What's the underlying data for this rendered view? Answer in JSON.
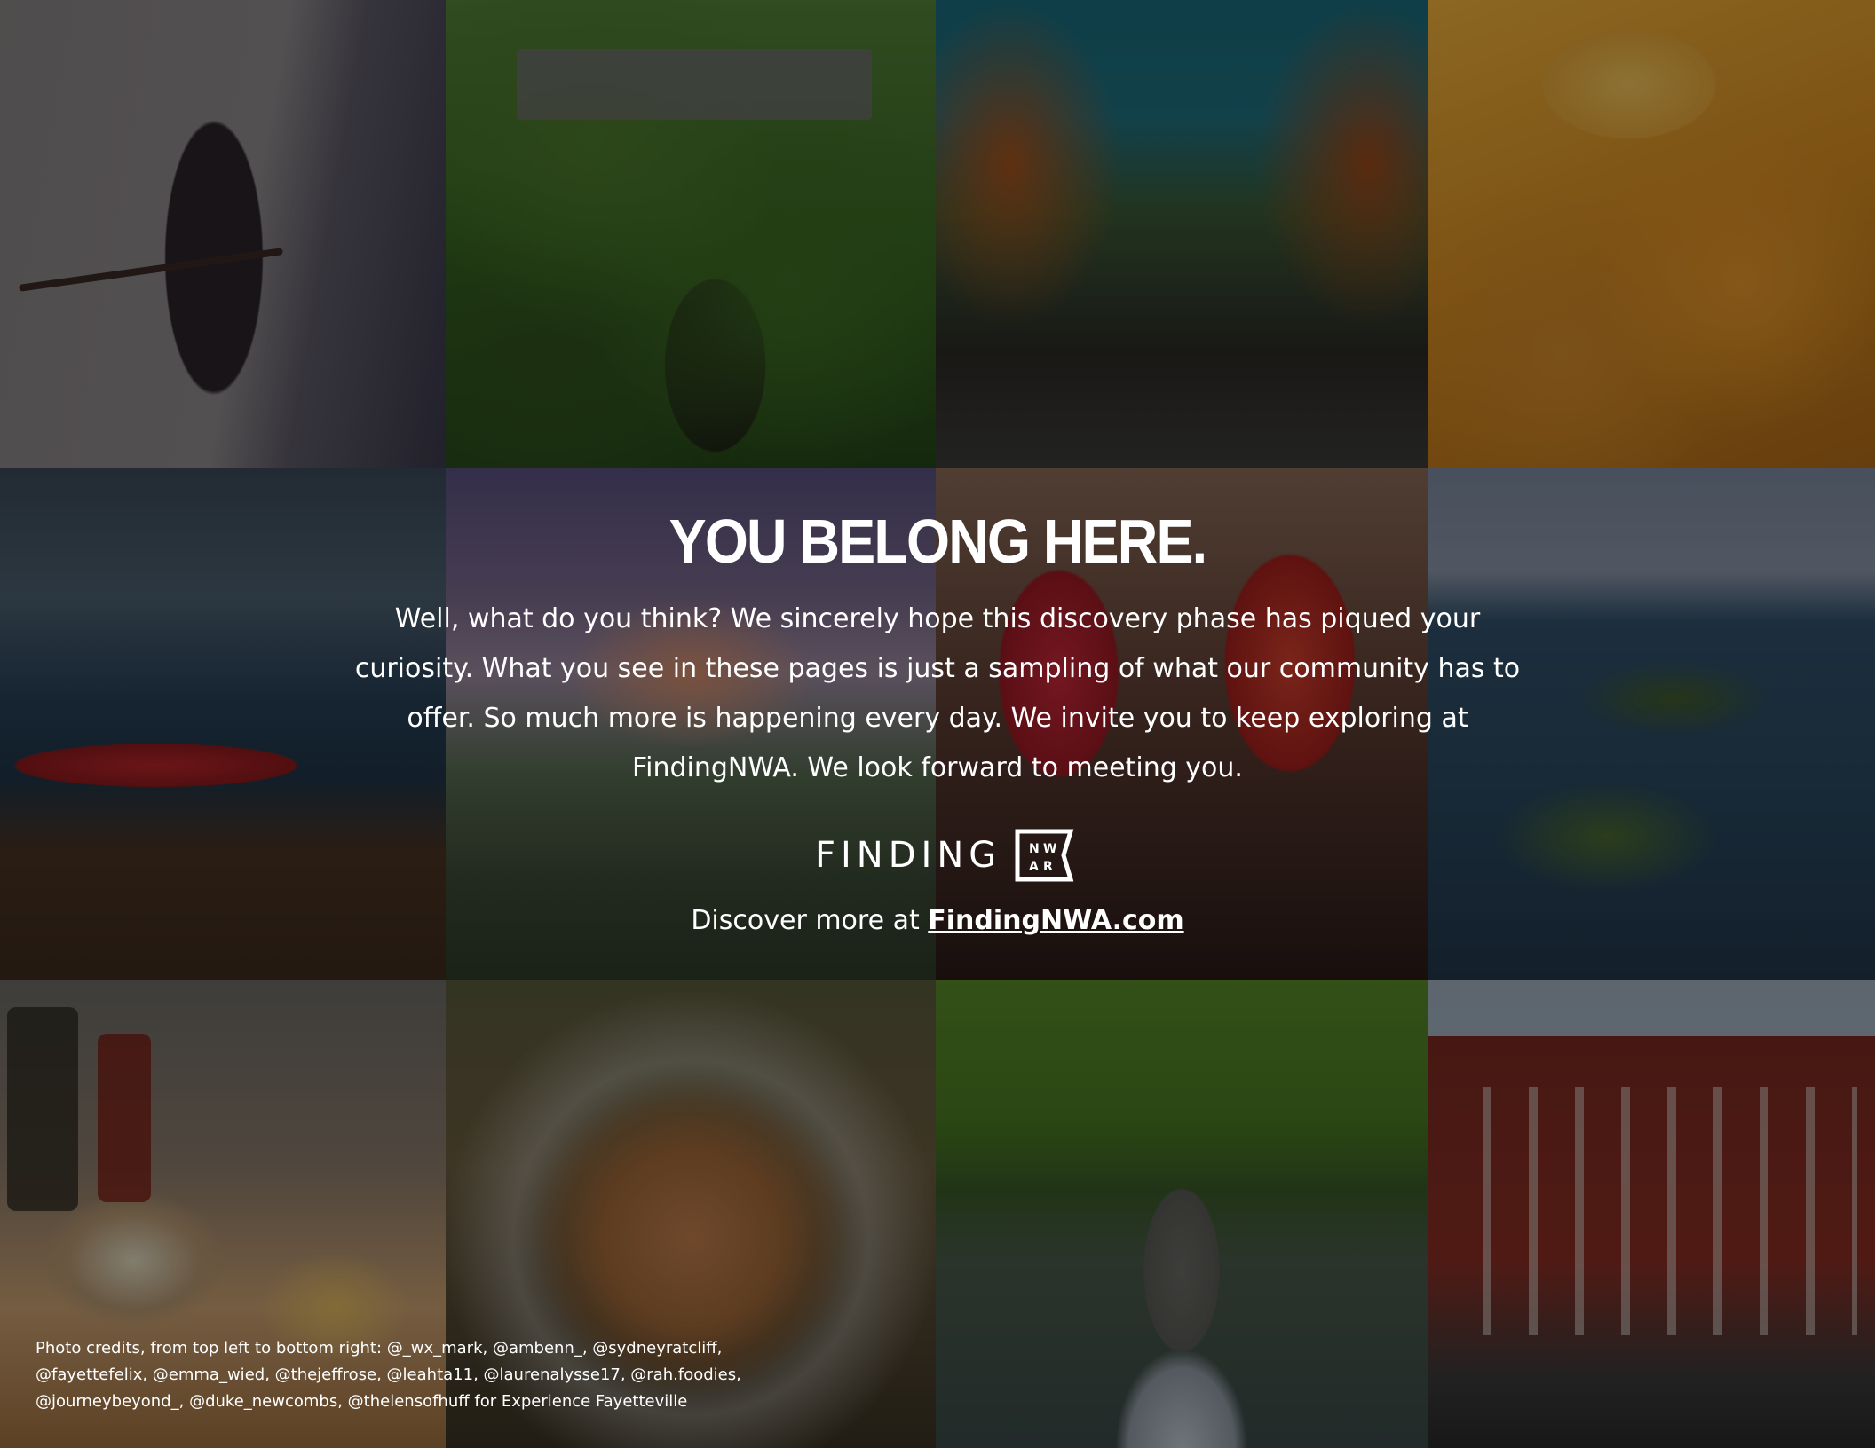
{
  "headline": "YOU BELONG HERE.",
  "body_text": "Well, what do you think? We sincerely hope this discovery phase has piqued your curiosity. What you see in these pages is just a sampling of what our community has to offer. So much more is happening every day. We invite you to keep exploring at FindingNWA. We look forward to meeting you.",
  "logo": {
    "word": "FINDING",
    "mark_letters": [
      "N",
      "W",
      "A",
      "R"
    ]
  },
  "discover": {
    "prefix": "Discover more at ",
    "link_text": "FindingNWA.com"
  },
  "credits": "Photo credits, from top left to bottom right: @_wx_mark, @ambenn_, @sydneyratcliff, @fayettefelix, @emma_wied, @thejeffrose, @leahta11, @laurenalysse17, @rah.foodies, @journeybeyond_, @duke_newcombs, @thelensofhuff for Experience Fayetteville",
  "colors": {
    "text": "#ffffff",
    "overlay": "rgba(0,0,0,0.42)"
  }
}
